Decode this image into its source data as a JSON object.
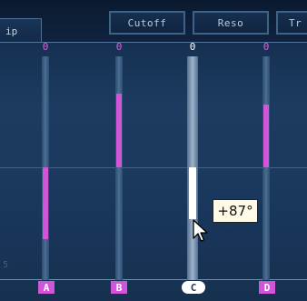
{
  "tabs": {
    "left_label": "ip"
  },
  "param_buttons": {
    "cutoff": "Cutoff",
    "reso": "Reso",
    "trans": "Tr"
  },
  "steps": [
    {
      "step": "A",
      "value_label": "0",
      "bar_value_pct": 32,
      "direction": "down"
    },
    {
      "step": "B",
      "value_label": "0",
      "bar_value_pct": 33,
      "direction": "up"
    },
    {
      "step": "C",
      "value_label": "0",
      "bar_value_pct": 23,
      "direction": "down",
      "active": true
    },
    {
      "step": "D",
      "value_label": "0",
      "bar_value_pct": 28,
      "direction": "up"
    }
  ],
  "side_digit": "5",
  "tooltip": {
    "text": "+87°"
  },
  "colors": {
    "accent": "#d254d8",
    "active": "#ffffff",
    "background": "#1d3b61"
  },
  "icons": {
    "cursor": "arrow-cursor-icon"
  }
}
